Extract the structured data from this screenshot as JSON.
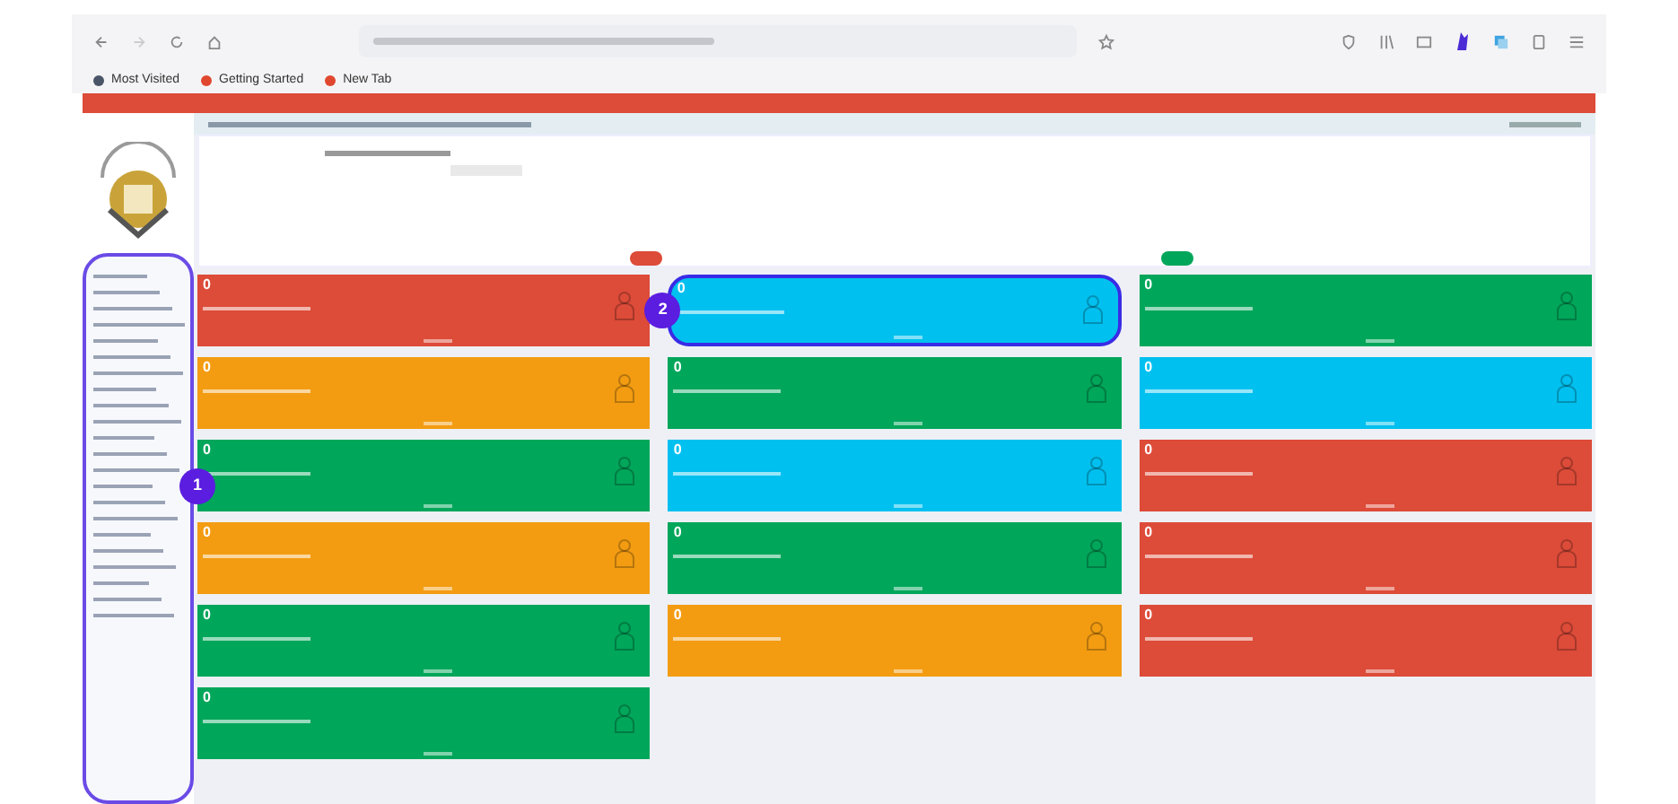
{
  "bookmarks": [
    {
      "label": "Most Visited",
      "color": "#4a5568"
    },
    {
      "label": "Getting Started",
      "color": "#e0472f"
    },
    {
      "label": "New Tab",
      "color": "#e0472f"
    }
  ],
  "sidebar": {
    "callout": "1"
  },
  "cards": [
    {
      "count": "0",
      "color": "#dd4b39"
    },
    {
      "count": "0",
      "color": "#00c0ef",
      "callout": "2"
    },
    {
      "count": "0",
      "color": "#00a65a"
    },
    {
      "count": "0",
      "color": "#f39c12"
    },
    {
      "count": "0",
      "color": "#00a65a"
    },
    {
      "count": "0",
      "color": "#00c0ef"
    },
    {
      "count": "0",
      "color": "#00a65a"
    },
    {
      "count": "0",
      "color": "#00c0ef"
    },
    {
      "count": "0",
      "color": "#dd4b39"
    },
    {
      "count": "0",
      "color": "#f39c12"
    },
    {
      "count": "0",
      "color": "#00a65a"
    },
    {
      "count": "0",
      "color": "#dd4b39"
    },
    {
      "count": "0",
      "color": "#00a65a"
    },
    {
      "count": "0",
      "color": "#f39c12"
    },
    {
      "count": "0",
      "color": "#dd4b39"
    },
    {
      "count": "0",
      "color": "#00a65a"
    }
  ]
}
